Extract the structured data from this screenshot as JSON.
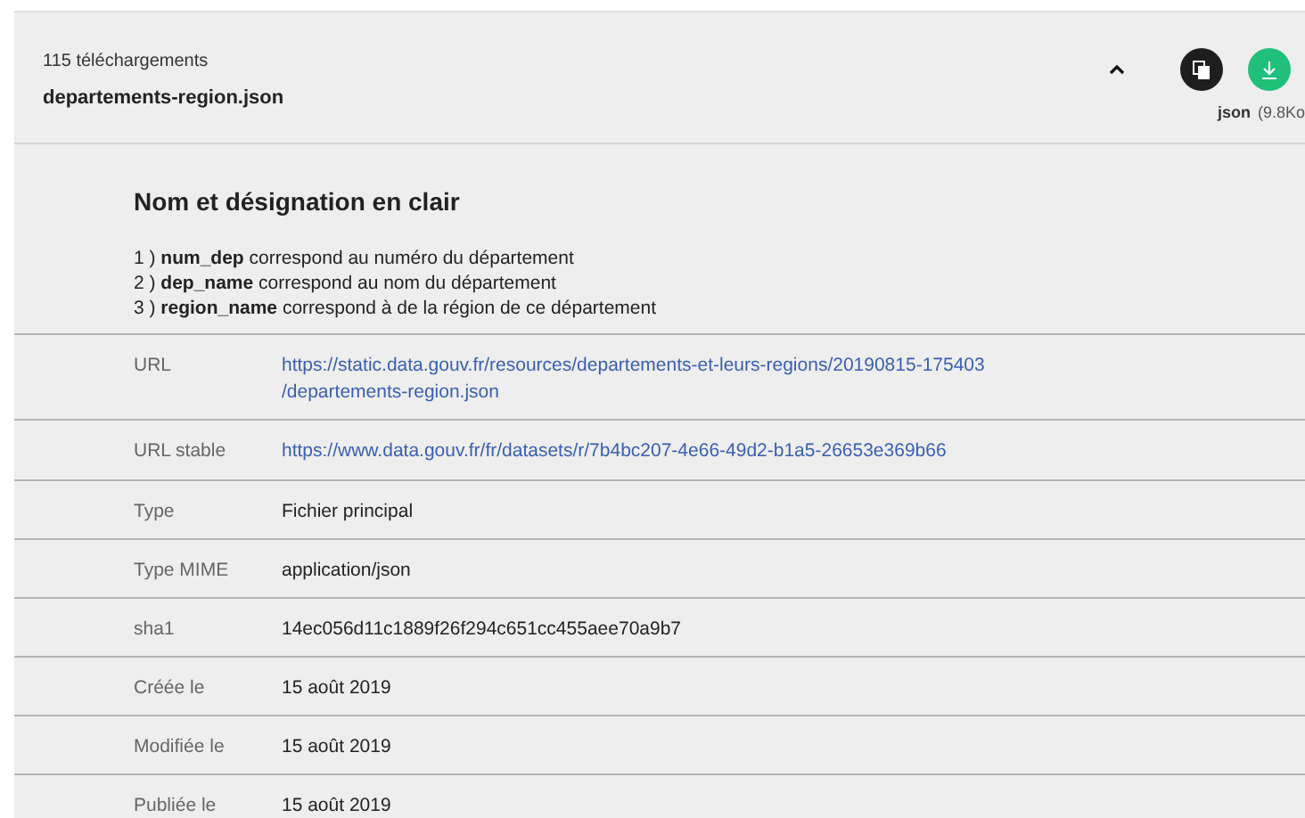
{
  "resource": {
    "downloads": "115 téléchargements",
    "filename": "departements-region.json",
    "expanded": true,
    "format": "json",
    "size": "(9.8Ko"
  },
  "description": {
    "title": "Nom et désignation en clair",
    "lines": [
      "1 ) **num_dep** correspond au numéro du département",
      "2 ) **dep_name** correspond au nom du département",
      "3 ) **region_name** correspond à de la région de ce département"
    ]
  },
  "details": [
    {
      "label": "URL",
      "kind": "link",
      "lines": [
        "https://static.data.gouv.fr/resources/departements-et-leurs-regions/20190815-175403",
        "/departements-region.json"
      ]
    },
    {
      "label": "URL stable",
      "kind": "link",
      "lines": [
        "https://www.data.gouv.fr/fr/datasets/r/7b4bc207-4e66-49d2-b1a5-26653e369b66"
      ]
    },
    {
      "label": "Type",
      "kind": "text",
      "lines": [
        "Fichier principal"
      ]
    },
    {
      "label": "Type MIME",
      "kind": "text",
      "lines": [
        "application/json"
      ]
    },
    {
      "label": "sha1",
      "kind": "text",
      "lines": [
        "14ec056d11c1889f26f294c651cc455aee70a9b7"
      ]
    },
    {
      "label": "Créée le",
      "kind": "text",
      "lines": [
        "15 août 2019"
      ]
    },
    {
      "label": "Modifiée le",
      "kind": "text",
      "lines": [
        "15 août 2019"
      ]
    },
    {
      "label": "Publiée le",
      "kind": "text",
      "lines": [
        "15 août 2019"
      ]
    }
  ]
}
